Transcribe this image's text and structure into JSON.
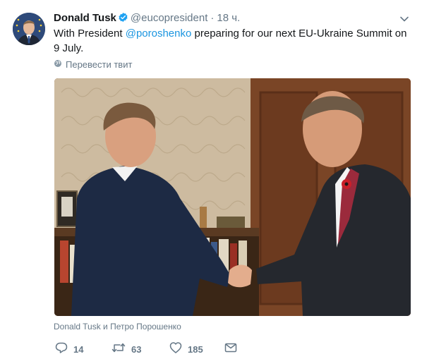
{
  "tweet": {
    "author_name": "Donald Tusk",
    "handle": "@eucopresident",
    "separator": "·",
    "time": "18 ч.",
    "text_before": "With President ",
    "mention": "@poroshenko",
    "text_after": " preparing for our next EU-Ukraine Summit on 9 July.",
    "translate_label": "Перевести твит",
    "photo_caption": "Donald Tusk и Петро Порошенко"
  },
  "actions": {
    "reply_count": "14",
    "retweet_count": "63",
    "like_count": "185"
  },
  "colors": {
    "link": "#1b95e0",
    "secondary": "#657786",
    "verified": "#1da1f2"
  },
  "icons": [
    "verified-badge-icon",
    "chevron-down-icon",
    "globe-icon",
    "reply-icon",
    "retweet-icon",
    "like-icon",
    "direct-message-icon"
  ]
}
